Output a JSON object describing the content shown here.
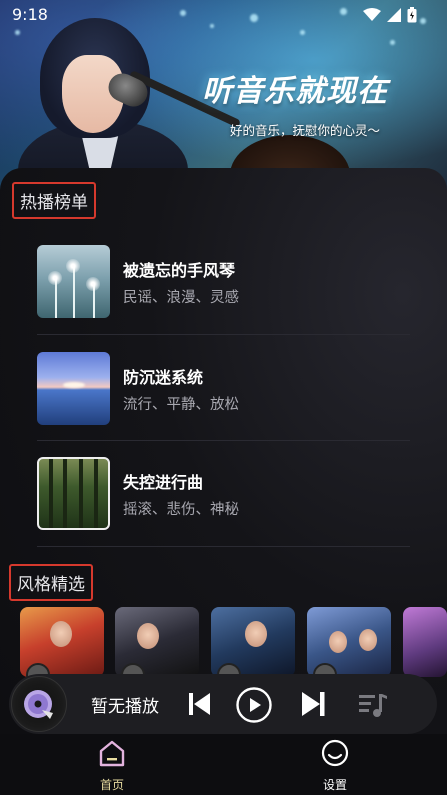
{
  "status_bar": {
    "time": "9:18"
  },
  "hero": {
    "title": "听音乐就现在",
    "subtitle": "好的音乐，抚慰你的心灵～"
  },
  "hot_chart": {
    "title": "热播榜单",
    "songs": [
      {
        "name": "被遗忘的手风琴",
        "tags": "民谣、浪漫、灵感"
      },
      {
        "name": "防沉迷系统",
        "tags": "流行、平静、放松"
      },
      {
        "name": "失控进行曲",
        "tags": "摇滚、悲伤、神秘"
      }
    ]
  },
  "styles": {
    "title": "风格精选"
  },
  "player": {
    "status": "暂无播放"
  },
  "nav": {
    "items": [
      {
        "label": "首页",
        "active": true
      },
      {
        "label": "设置",
        "active": false
      }
    ],
    "active_color": "#e8dca0",
    "inactive_color": "#ffffff"
  },
  "colors": {
    "background": "#0d0d10",
    "highlight_border": "#d6392d",
    "secondary_text": "#a8a8b0"
  }
}
